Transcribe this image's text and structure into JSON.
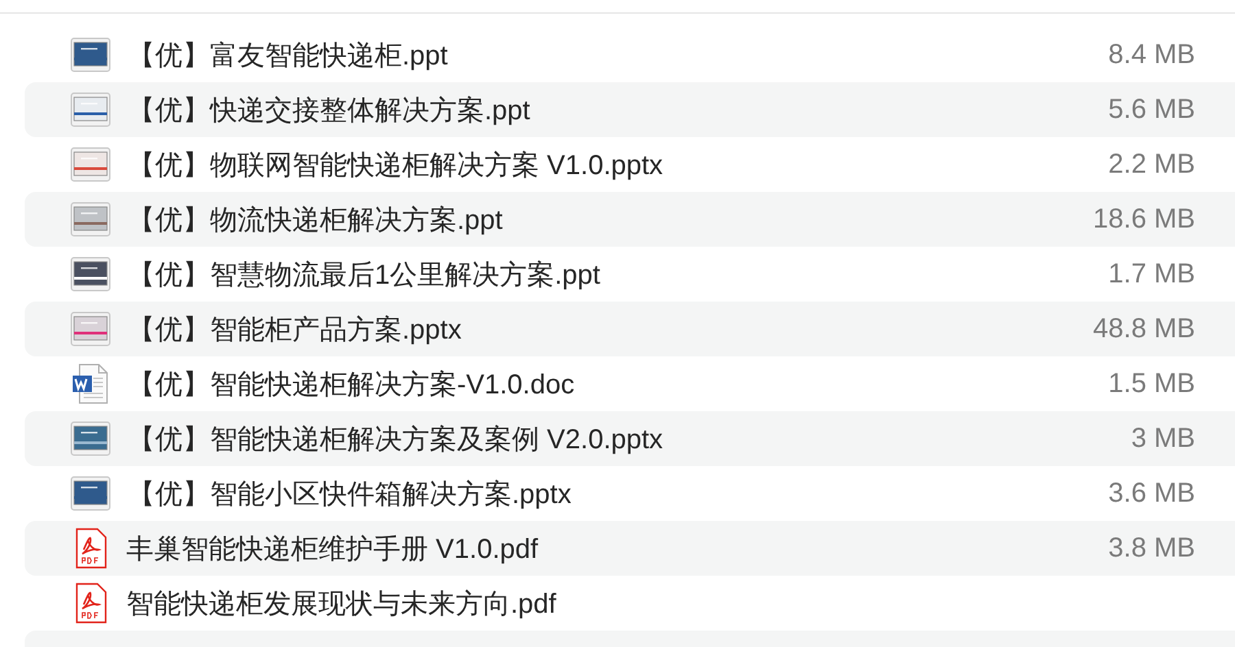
{
  "files": [
    {
      "name": "【优】富友智能快递柜.ppt",
      "size": "8.4 MB",
      "kind": "slides"
    },
    {
      "name": "【优】快递交接整体解决方案.ppt",
      "size": "5.6 MB",
      "kind": "slides"
    },
    {
      "name": "【优】物联网智能快递柜解决方案 V1.0.pptx",
      "size": "2.2 MB",
      "kind": "slides"
    },
    {
      "name": "【优】物流快递柜解决方案.ppt",
      "size": "18.6 MB",
      "kind": "slides"
    },
    {
      "name": "【优】智慧物流最后1公里解决方案.ppt",
      "size": "1.7 MB",
      "kind": "slides"
    },
    {
      "name": "【优】智能柜产品方案.pptx",
      "size": "48.8 MB",
      "kind": "slides"
    },
    {
      "name": "【优】智能快递柜解决方案-V1.0.doc",
      "size": "1.5 MB",
      "kind": "word"
    },
    {
      "name": "【优】智能快递柜解决方案及案例 V2.0.pptx",
      "size": "3 MB",
      "kind": "slides"
    },
    {
      "name": "【优】智能小区快件箱解决方案.pptx",
      "size": "3.6 MB",
      "kind": "slides"
    },
    {
      "name": "丰巢智能快递柜维护手册 V1.0.pdf",
      "size": "3.8 MB",
      "kind": "pdf"
    },
    {
      "name": "智能快递柜发展现状与未来方向.pdf",
      "kind": "pdf"
    }
  ]
}
